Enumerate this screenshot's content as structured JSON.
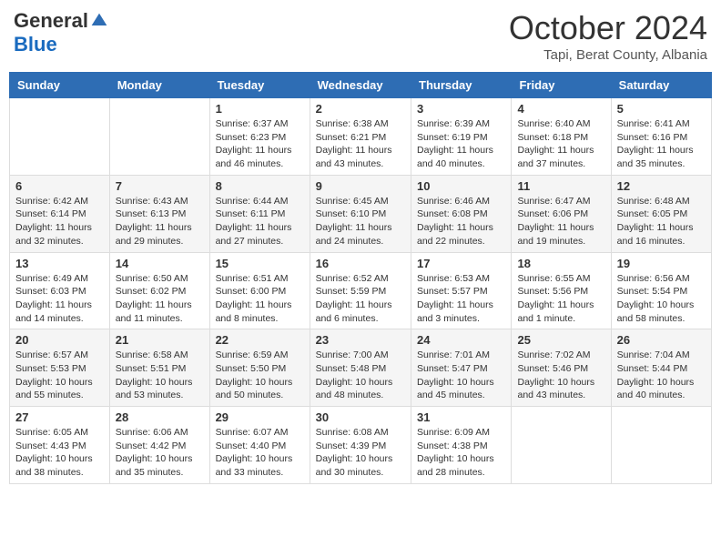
{
  "header": {
    "logo_general": "General",
    "logo_blue": "Blue",
    "month_title": "October 2024",
    "location": "Tapi, Berat County, Albania"
  },
  "days_of_week": [
    "Sunday",
    "Monday",
    "Tuesday",
    "Wednesday",
    "Thursday",
    "Friday",
    "Saturday"
  ],
  "weeks": [
    [
      {
        "day": "",
        "content": ""
      },
      {
        "day": "",
        "content": ""
      },
      {
        "day": "1",
        "content": "Sunrise: 6:37 AM\nSunset: 6:23 PM\nDaylight: 11 hours and 46 minutes."
      },
      {
        "day": "2",
        "content": "Sunrise: 6:38 AM\nSunset: 6:21 PM\nDaylight: 11 hours and 43 minutes."
      },
      {
        "day": "3",
        "content": "Sunrise: 6:39 AM\nSunset: 6:19 PM\nDaylight: 11 hours and 40 minutes."
      },
      {
        "day": "4",
        "content": "Sunrise: 6:40 AM\nSunset: 6:18 PM\nDaylight: 11 hours and 37 minutes."
      },
      {
        "day": "5",
        "content": "Sunrise: 6:41 AM\nSunset: 6:16 PM\nDaylight: 11 hours and 35 minutes."
      }
    ],
    [
      {
        "day": "6",
        "content": "Sunrise: 6:42 AM\nSunset: 6:14 PM\nDaylight: 11 hours and 32 minutes."
      },
      {
        "day": "7",
        "content": "Sunrise: 6:43 AM\nSunset: 6:13 PM\nDaylight: 11 hours and 29 minutes."
      },
      {
        "day": "8",
        "content": "Sunrise: 6:44 AM\nSunset: 6:11 PM\nDaylight: 11 hours and 27 minutes."
      },
      {
        "day": "9",
        "content": "Sunrise: 6:45 AM\nSunset: 6:10 PM\nDaylight: 11 hours and 24 minutes."
      },
      {
        "day": "10",
        "content": "Sunrise: 6:46 AM\nSunset: 6:08 PM\nDaylight: 11 hours and 22 minutes."
      },
      {
        "day": "11",
        "content": "Sunrise: 6:47 AM\nSunset: 6:06 PM\nDaylight: 11 hours and 19 minutes."
      },
      {
        "day": "12",
        "content": "Sunrise: 6:48 AM\nSunset: 6:05 PM\nDaylight: 11 hours and 16 minutes."
      }
    ],
    [
      {
        "day": "13",
        "content": "Sunrise: 6:49 AM\nSunset: 6:03 PM\nDaylight: 11 hours and 14 minutes."
      },
      {
        "day": "14",
        "content": "Sunrise: 6:50 AM\nSunset: 6:02 PM\nDaylight: 11 hours and 11 minutes."
      },
      {
        "day": "15",
        "content": "Sunrise: 6:51 AM\nSunset: 6:00 PM\nDaylight: 11 hours and 8 minutes."
      },
      {
        "day": "16",
        "content": "Sunrise: 6:52 AM\nSunset: 5:59 PM\nDaylight: 11 hours and 6 minutes."
      },
      {
        "day": "17",
        "content": "Sunrise: 6:53 AM\nSunset: 5:57 PM\nDaylight: 11 hours and 3 minutes."
      },
      {
        "day": "18",
        "content": "Sunrise: 6:55 AM\nSunset: 5:56 PM\nDaylight: 11 hours and 1 minute."
      },
      {
        "day": "19",
        "content": "Sunrise: 6:56 AM\nSunset: 5:54 PM\nDaylight: 10 hours and 58 minutes."
      }
    ],
    [
      {
        "day": "20",
        "content": "Sunrise: 6:57 AM\nSunset: 5:53 PM\nDaylight: 10 hours and 55 minutes."
      },
      {
        "day": "21",
        "content": "Sunrise: 6:58 AM\nSunset: 5:51 PM\nDaylight: 10 hours and 53 minutes."
      },
      {
        "day": "22",
        "content": "Sunrise: 6:59 AM\nSunset: 5:50 PM\nDaylight: 10 hours and 50 minutes."
      },
      {
        "day": "23",
        "content": "Sunrise: 7:00 AM\nSunset: 5:48 PM\nDaylight: 10 hours and 48 minutes."
      },
      {
        "day": "24",
        "content": "Sunrise: 7:01 AM\nSunset: 5:47 PM\nDaylight: 10 hours and 45 minutes."
      },
      {
        "day": "25",
        "content": "Sunrise: 7:02 AM\nSunset: 5:46 PM\nDaylight: 10 hours and 43 minutes."
      },
      {
        "day": "26",
        "content": "Sunrise: 7:04 AM\nSunset: 5:44 PM\nDaylight: 10 hours and 40 minutes."
      }
    ],
    [
      {
        "day": "27",
        "content": "Sunrise: 6:05 AM\nSunset: 4:43 PM\nDaylight: 10 hours and 38 minutes."
      },
      {
        "day": "28",
        "content": "Sunrise: 6:06 AM\nSunset: 4:42 PM\nDaylight: 10 hours and 35 minutes."
      },
      {
        "day": "29",
        "content": "Sunrise: 6:07 AM\nSunset: 4:40 PM\nDaylight: 10 hours and 33 minutes."
      },
      {
        "day": "30",
        "content": "Sunrise: 6:08 AM\nSunset: 4:39 PM\nDaylight: 10 hours and 30 minutes."
      },
      {
        "day": "31",
        "content": "Sunrise: 6:09 AM\nSunset: 4:38 PM\nDaylight: 10 hours and 28 minutes."
      },
      {
        "day": "",
        "content": ""
      },
      {
        "day": "",
        "content": ""
      }
    ]
  ]
}
